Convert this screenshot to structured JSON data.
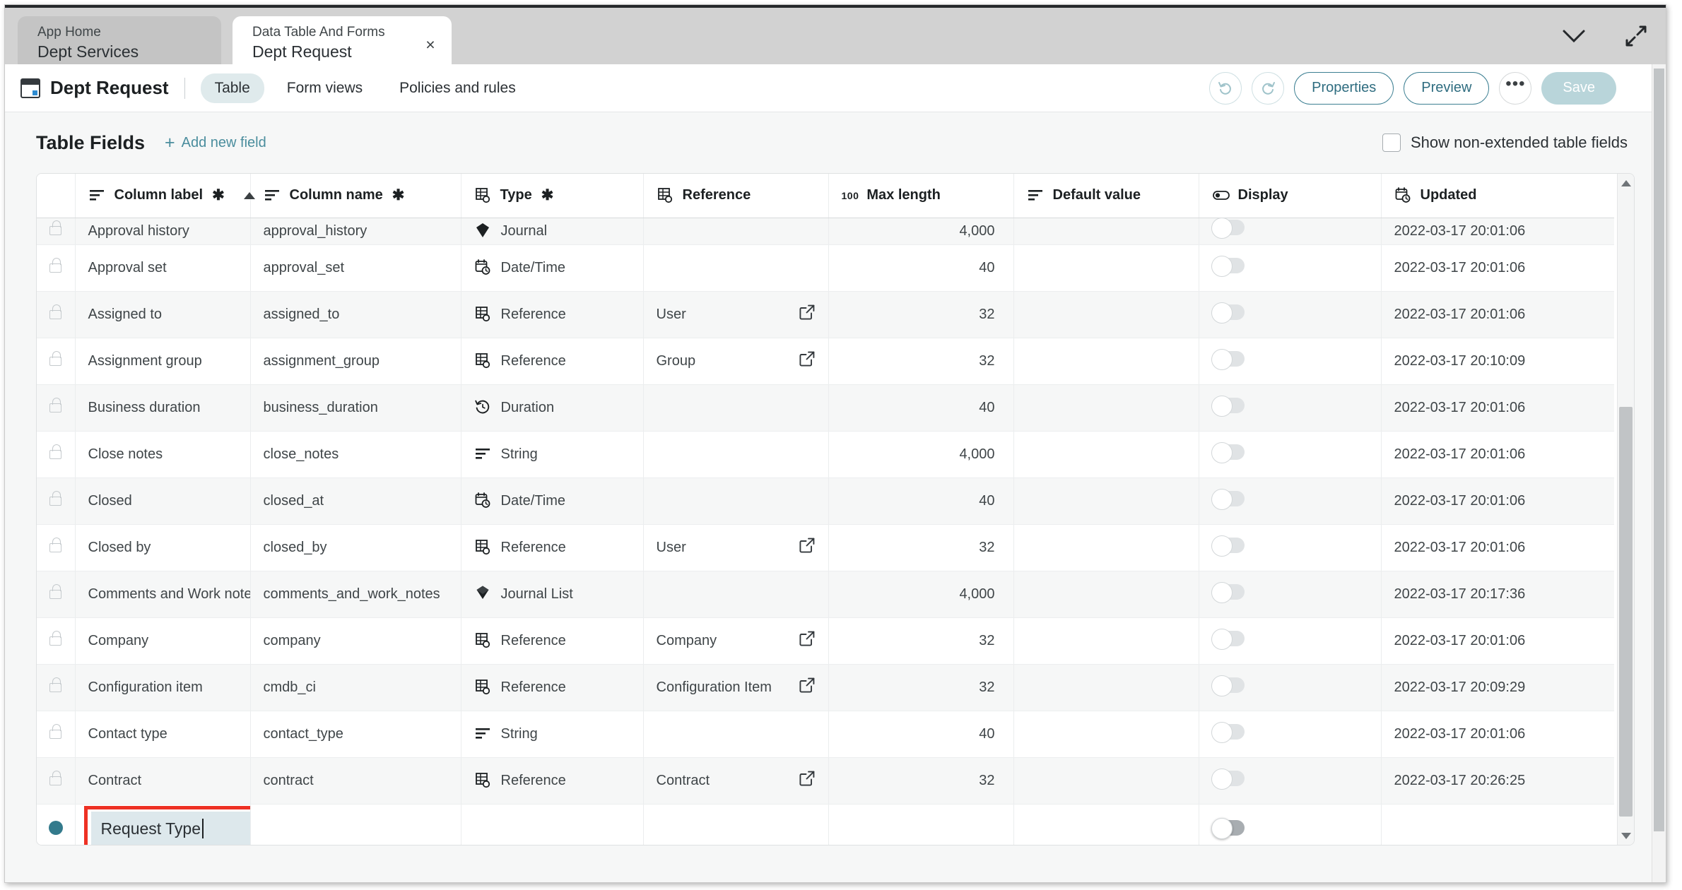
{
  "window": {
    "tabs": [
      {
        "sub": "App Home",
        "main": "Dept Services",
        "active": false
      },
      {
        "sub": "Data Table And Forms",
        "main": "Dept Request",
        "active": true
      }
    ],
    "close_label": "×",
    "collapse_icon": "chevron-down-icon",
    "expand_icon": "expand-arrows-icon"
  },
  "header": {
    "title": "Dept Request",
    "nav": [
      {
        "label": "Table",
        "selected": true
      },
      {
        "label": "Form views",
        "selected": false
      },
      {
        "label": "Policies and rules",
        "selected": false
      }
    ],
    "actions": {
      "undo": "undo-icon",
      "redo": "redo-icon",
      "properties": "Properties",
      "preview": "Preview",
      "more": "•••",
      "save": "Save"
    }
  },
  "section": {
    "title": "Table Fields",
    "add_new_field": "Add new field",
    "add_plus": "+",
    "show_non_extended": "Show non-extended table fields",
    "show_non_extended_checked": false
  },
  "table": {
    "columns": [
      {
        "label": "Column label",
        "icon": "string-icon",
        "required": true,
        "sorted": "asc"
      },
      {
        "label": "Column name",
        "icon": "string-icon",
        "required": true
      },
      {
        "label": "Type",
        "icon": "reference-icon",
        "required": true
      },
      {
        "label": "Reference",
        "icon": "reference-icon",
        "required": false
      },
      {
        "label": "Max length",
        "icon": "100",
        "required": false
      },
      {
        "label": "Default value",
        "icon": "string-icon",
        "required": false
      },
      {
        "label": "Display",
        "icon": "toggle-icon",
        "required": false
      },
      {
        "label": "Updated",
        "icon": "datetime-icon",
        "required": false
      }
    ],
    "rows": [
      {
        "locked": true,
        "column_label": "Approval history",
        "column_name": "approval_history",
        "type": "Journal",
        "type_icon": "journal-icon",
        "reference": "",
        "max_length": "4,000",
        "default_value": "",
        "display": false,
        "updated": "2022-03-17 20:01:06",
        "clipped": true
      },
      {
        "locked": true,
        "column_label": "Approval set",
        "column_name": "approval_set",
        "type": "Date/Time",
        "type_icon": "datetime-icon",
        "reference": "",
        "max_length": "40",
        "default_value": "",
        "display": false,
        "updated": "2022-03-17 20:01:06"
      },
      {
        "locked": true,
        "column_label": "Assigned to",
        "column_name": "assigned_to",
        "type": "Reference",
        "type_icon": "reference-icon",
        "reference": "User",
        "max_length": "32",
        "default_value": "",
        "display": false,
        "updated": "2022-03-17 20:01:06"
      },
      {
        "locked": true,
        "column_label": "Assignment group",
        "column_name": "assignment_group",
        "type": "Reference",
        "type_icon": "reference-icon",
        "reference": "Group",
        "max_length": "32",
        "default_value": "",
        "display": false,
        "updated": "2022-03-17 20:10:09"
      },
      {
        "locked": true,
        "column_label": "Business duration",
        "column_name": "business_duration",
        "type": "Duration",
        "type_icon": "duration-icon",
        "reference": "",
        "max_length": "40",
        "default_value": "",
        "display": false,
        "updated": "2022-03-17 20:01:06"
      },
      {
        "locked": true,
        "column_label": "Close notes",
        "column_name": "close_notes",
        "type": "String",
        "type_icon": "string-icon",
        "reference": "",
        "max_length": "4,000",
        "default_value": "",
        "display": false,
        "updated": "2022-03-17 20:01:06"
      },
      {
        "locked": true,
        "column_label": "Closed",
        "column_name": "closed_at",
        "type": "Date/Time",
        "type_icon": "datetime-icon",
        "reference": "",
        "max_length": "40",
        "default_value": "",
        "display": false,
        "updated": "2022-03-17 20:01:06"
      },
      {
        "locked": true,
        "column_label": "Closed by",
        "column_name": "closed_by",
        "type": "Reference",
        "type_icon": "reference-icon",
        "reference": "User",
        "max_length": "32",
        "default_value": "",
        "display": false,
        "updated": "2022-03-17 20:01:06"
      },
      {
        "locked": true,
        "column_label": "Comments and Work notes",
        "column_name": "comments_and_work_notes",
        "type": "Journal List",
        "type_icon": "journal-list-icon",
        "reference": "",
        "max_length": "4,000",
        "default_value": "",
        "display": false,
        "updated": "2022-03-17 20:17:36"
      },
      {
        "locked": true,
        "column_label": "Company",
        "column_name": "company",
        "type": "Reference",
        "type_icon": "reference-icon",
        "reference": "Company",
        "max_length": "32",
        "default_value": "",
        "display": false,
        "updated": "2022-03-17 20:01:06"
      },
      {
        "locked": true,
        "column_label": "Configuration item",
        "column_name": "cmdb_ci",
        "type": "Reference",
        "type_icon": "reference-icon",
        "reference": "Configuration Item",
        "max_length": "32",
        "default_value": "",
        "display": false,
        "updated": "2022-03-17 20:09:29"
      },
      {
        "locked": true,
        "column_label": "Contact type",
        "column_name": "contact_type",
        "type": "String",
        "type_icon": "string-icon",
        "reference": "",
        "max_length": "40",
        "default_value": "",
        "display": false,
        "updated": "2022-03-17 20:01:06"
      },
      {
        "locked": true,
        "column_label": "Contract",
        "column_name": "contract",
        "type": "Reference",
        "type_icon": "reference-icon",
        "reference": "Contract",
        "max_length": "32",
        "default_value": "",
        "display": false,
        "updated": "2022-03-17 20:26:25"
      }
    ],
    "new_row": {
      "column_label_value": "Request Type",
      "column_name": "",
      "type": "",
      "reference": "",
      "max_length": "",
      "default_value": "",
      "display": true,
      "updated": ""
    }
  },
  "colors": {
    "accent": "#2f6d80",
    "highlight_border": "#ee3124",
    "field_bg": "#dde8ec",
    "dot": "#337a8c"
  }
}
